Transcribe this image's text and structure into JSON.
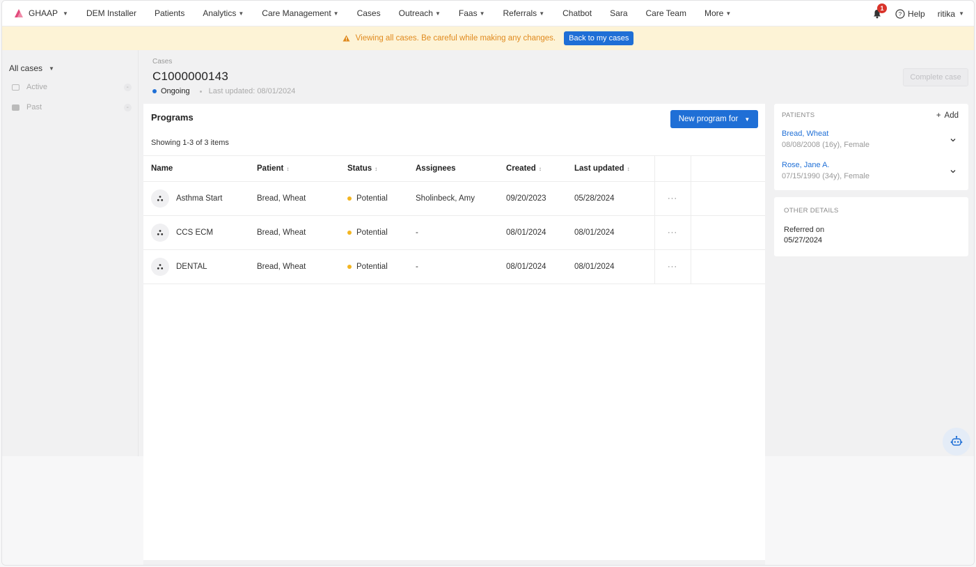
{
  "nav": {
    "brand": "GHAAP",
    "items": [
      {
        "label": "DEM Installer",
        "caret": false
      },
      {
        "label": "Patients",
        "caret": false
      },
      {
        "label": "Analytics",
        "caret": true
      },
      {
        "label": "Care Management",
        "caret": true
      },
      {
        "label": "Cases",
        "caret": false
      },
      {
        "label": "Outreach",
        "caret": true
      },
      {
        "label": "Faas",
        "caret": true
      },
      {
        "label": "Referrals",
        "caret": true
      },
      {
        "label": "Chatbot",
        "caret": false
      },
      {
        "label": "Sara",
        "caret": false
      },
      {
        "label": "Care Team",
        "caret": false
      },
      {
        "label": "More",
        "caret": true
      }
    ],
    "notification_count": "1",
    "help_label": "Help",
    "user": "ritika"
  },
  "banner": {
    "message": "Viewing all cases. Be careful while making any changes.",
    "button_label": "Back to my cases"
  },
  "sidebar": {
    "filter_label": "All cases",
    "items": [
      {
        "label": "Active",
        "count": "-"
      },
      {
        "label": "Past",
        "count": "-"
      }
    ]
  },
  "case": {
    "breadcrumb": "Cases",
    "id": "C1000000143",
    "status": "Ongoing",
    "last_updated": "Last updated: 08/01/2024",
    "complete_button": "Complete case"
  },
  "programs": {
    "title": "Programs",
    "new_button": "New program for",
    "showing": "Showing 1-3 of 3 items",
    "columns": [
      "Name",
      "Patient",
      "Status",
      "Assignees",
      "Created",
      "Last updated"
    ],
    "rows": [
      {
        "name": "Asthma Start",
        "patient": "Bread, Wheat",
        "status": "Potential",
        "assignees": "Sholinbeck, Amy",
        "created": "09/20/2023",
        "updated": "05/28/2024"
      },
      {
        "name": "CCS ECM",
        "patient": "Bread, Wheat",
        "status": "Potential",
        "assignees": "-",
        "created": "08/01/2024",
        "updated": "08/01/2024"
      },
      {
        "name": "DENTAL",
        "patient": "Bread, Wheat",
        "status": "Potential",
        "assignees": "-",
        "created": "08/01/2024",
        "updated": "08/01/2024"
      }
    ],
    "row_action": "···"
  },
  "patients_panel": {
    "label": "PATIENTS",
    "add_label": "Add",
    "patients": [
      {
        "name": "Bread, Wheat",
        "meta": "08/08/2008 (16y), Female"
      },
      {
        "name": "Rose, Jane A.",
        "meta": "07/15/1990 (34y), Female"
      }
    ]
  },
  "other_details": {
    "label": "OTHER DETAILS",
    "referred_label": "Referred on",
    "referred_value": "05/27/2024"
  },
  "colors": {
    "primary": "#1f6fd6",
    "warning_text": "#e08a1e",
    "warning_bg": "#fdf3d6",
    "status_potential": "#f3b521",
    "badge": "#d9342b"
  }
}
